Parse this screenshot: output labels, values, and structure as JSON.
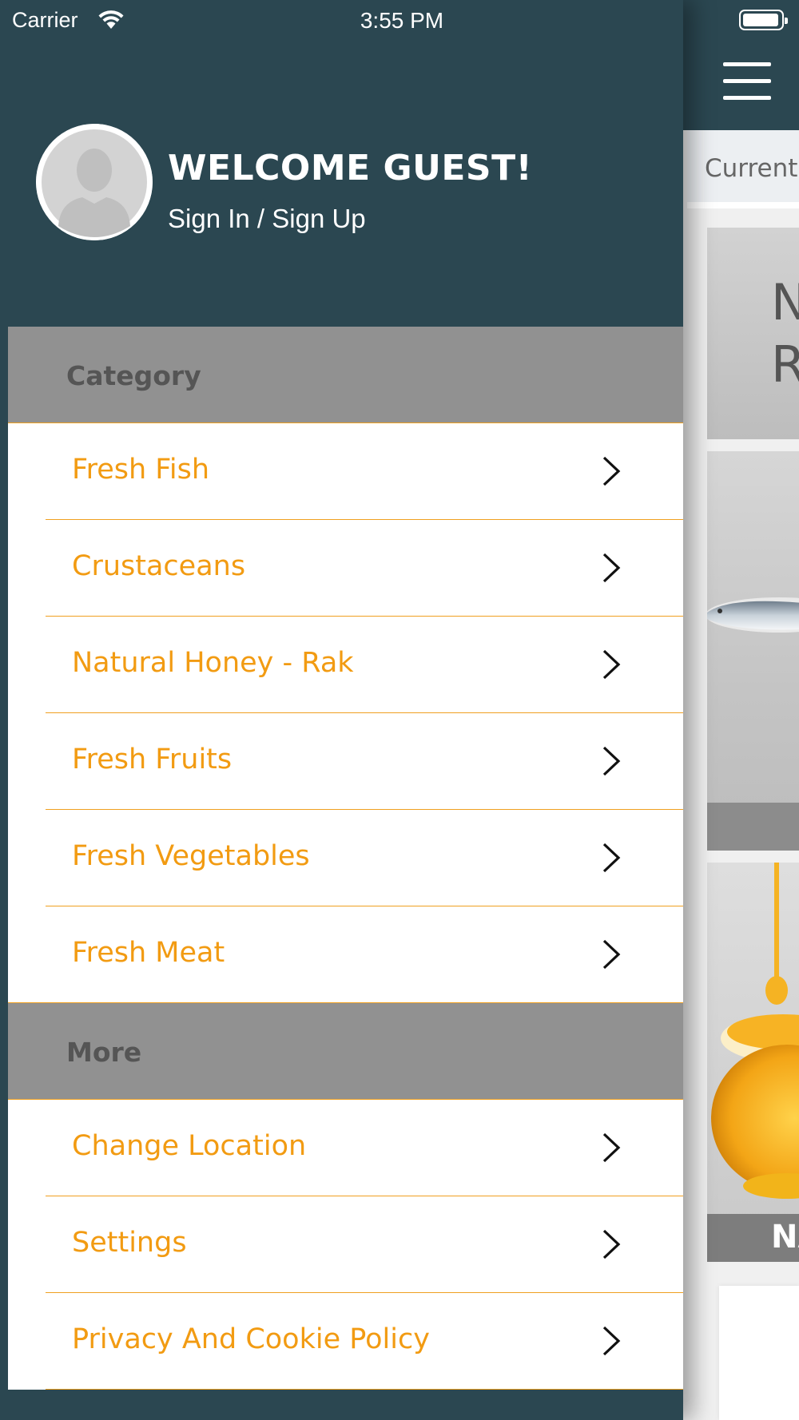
{
  "status_bar": {
    "carrier": "Carrier",
    "time": "3:55 PM"
  },
  "drawer": {
    "welcome_title": "WELCOME GUEST!",
    "sign_in_link": "Sign In / Sign Up",
    "sections": [
      {
        "title": "Category",
        "items": [
          {
            "label": "Fresh Fish"
          },
          {
            "label": "Crustaceans"
          },
          {
            "label": "Natural Honey - Rak"
          },
          {
            "label": "Fresh Fruits"
          },
          {
            "label": "Fresh Vegetables"
          },
          {
            "label": "Fresh Meat"
          }
        ]
      },
      {
        "title": "More",
        "items": [
          {
            "label": "Change Location"
          },
          {
            "label": "Settings"
          },
          {
            "label": "Privacy And Cookie Policy"
          }
        ]
      }
    ]
  },
  "main": {
    "location_label": "Current",
    "banner1_lines": [
      "N",
      "R"
    ],
    "banner3_label": "NA"
  },
  "colors": {
    "header_bg": "#2b4751",
    "accent": "#f29b12",
    "section_bg": "#919191"
  }
}
